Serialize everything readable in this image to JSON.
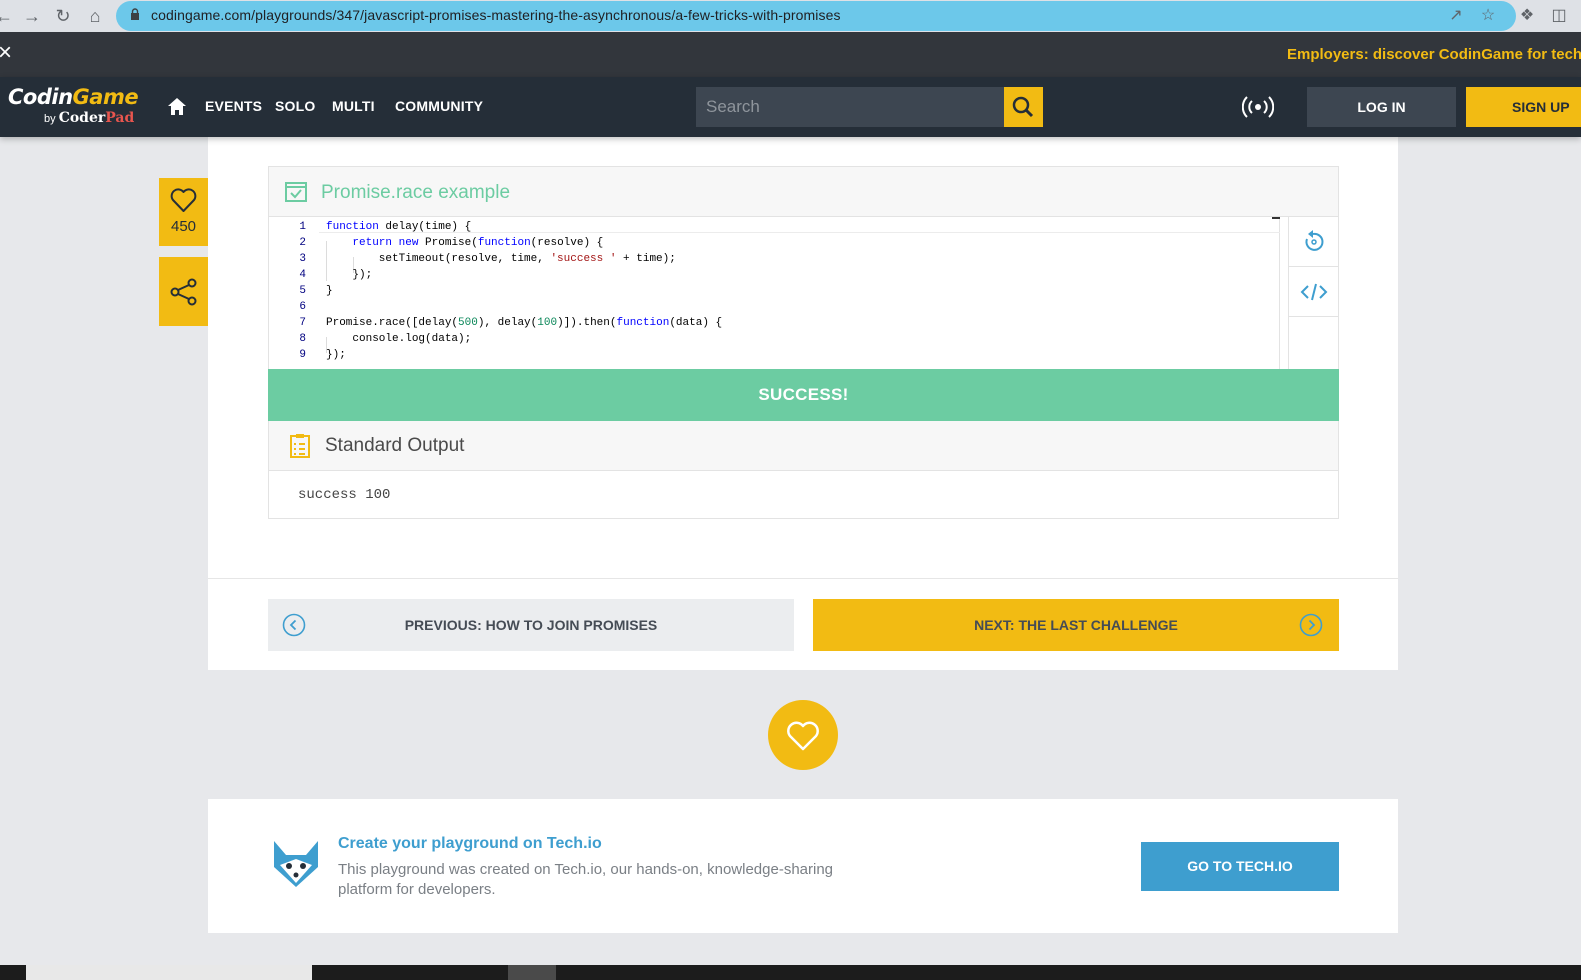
{
  "browser": {
    "url": "codingame.com/playgrounds/347/javascript-promises-mastering-the-asynchronous/a-few-tricks-with-promises"
  },
  "announcement": {
    "close": "×",
    "message": "Employers: discover CodinGame for tech hiring"
  },
  "navbar": {
    "logo_codin": "Codin",
    "logo_game": "Game",
    "logo_by": "by ",
    "logo_coder": "Coder",
    "logo_pad": "Pad",
    "items": [
      "EVENTS",
      "SOLO",
      "MULTI",
      "COMMUNITY"
    ],
    "search_placeholder": "Search",
    "login": "LOG IN",
    "signup": "SIGN UP"
  },
  "sidebar": {
    "likes": "450"
  },
  "widget": {
    "title": "Promise.race example",
    "code_lines": [
      {
        "num": "1"
      },
      {
        "num": "2"
      },
      {
        "num": "3"
      },
      {
        "num": "4"
      },
      {
        "num": "5"
      },
      {
        "num": "6"
      },
      {
        "num": "7"
      },
      {
        "num": "8"
      },
      {
        "num": "9"
      }
    ],
    "result": "SUCCESS!",
    "stdout_title": "Standard Output",
    "stdout": "success 100"
  },
  "pagination": {
    "prev": "PREVIOUS: HOW TO JOIN PROMISES",
    "next": "NEXT: THE LAST CHALLENGE"
  },
  "techio": {
    "title": "Create your playground on Tech.io",
    "description": "This playground was created on Tech.io, our hands-on, knowledge-sharing platform for developers.",
    "button": "GO TO TECH.IO"
  },
  "colors": {
    "accent_yellow": "#f2bb13",
    "success_green": "#6ccca2",
    "navbar_dark": "#252e38",
    "link_blue": "#3e9ecf"
  }
}
